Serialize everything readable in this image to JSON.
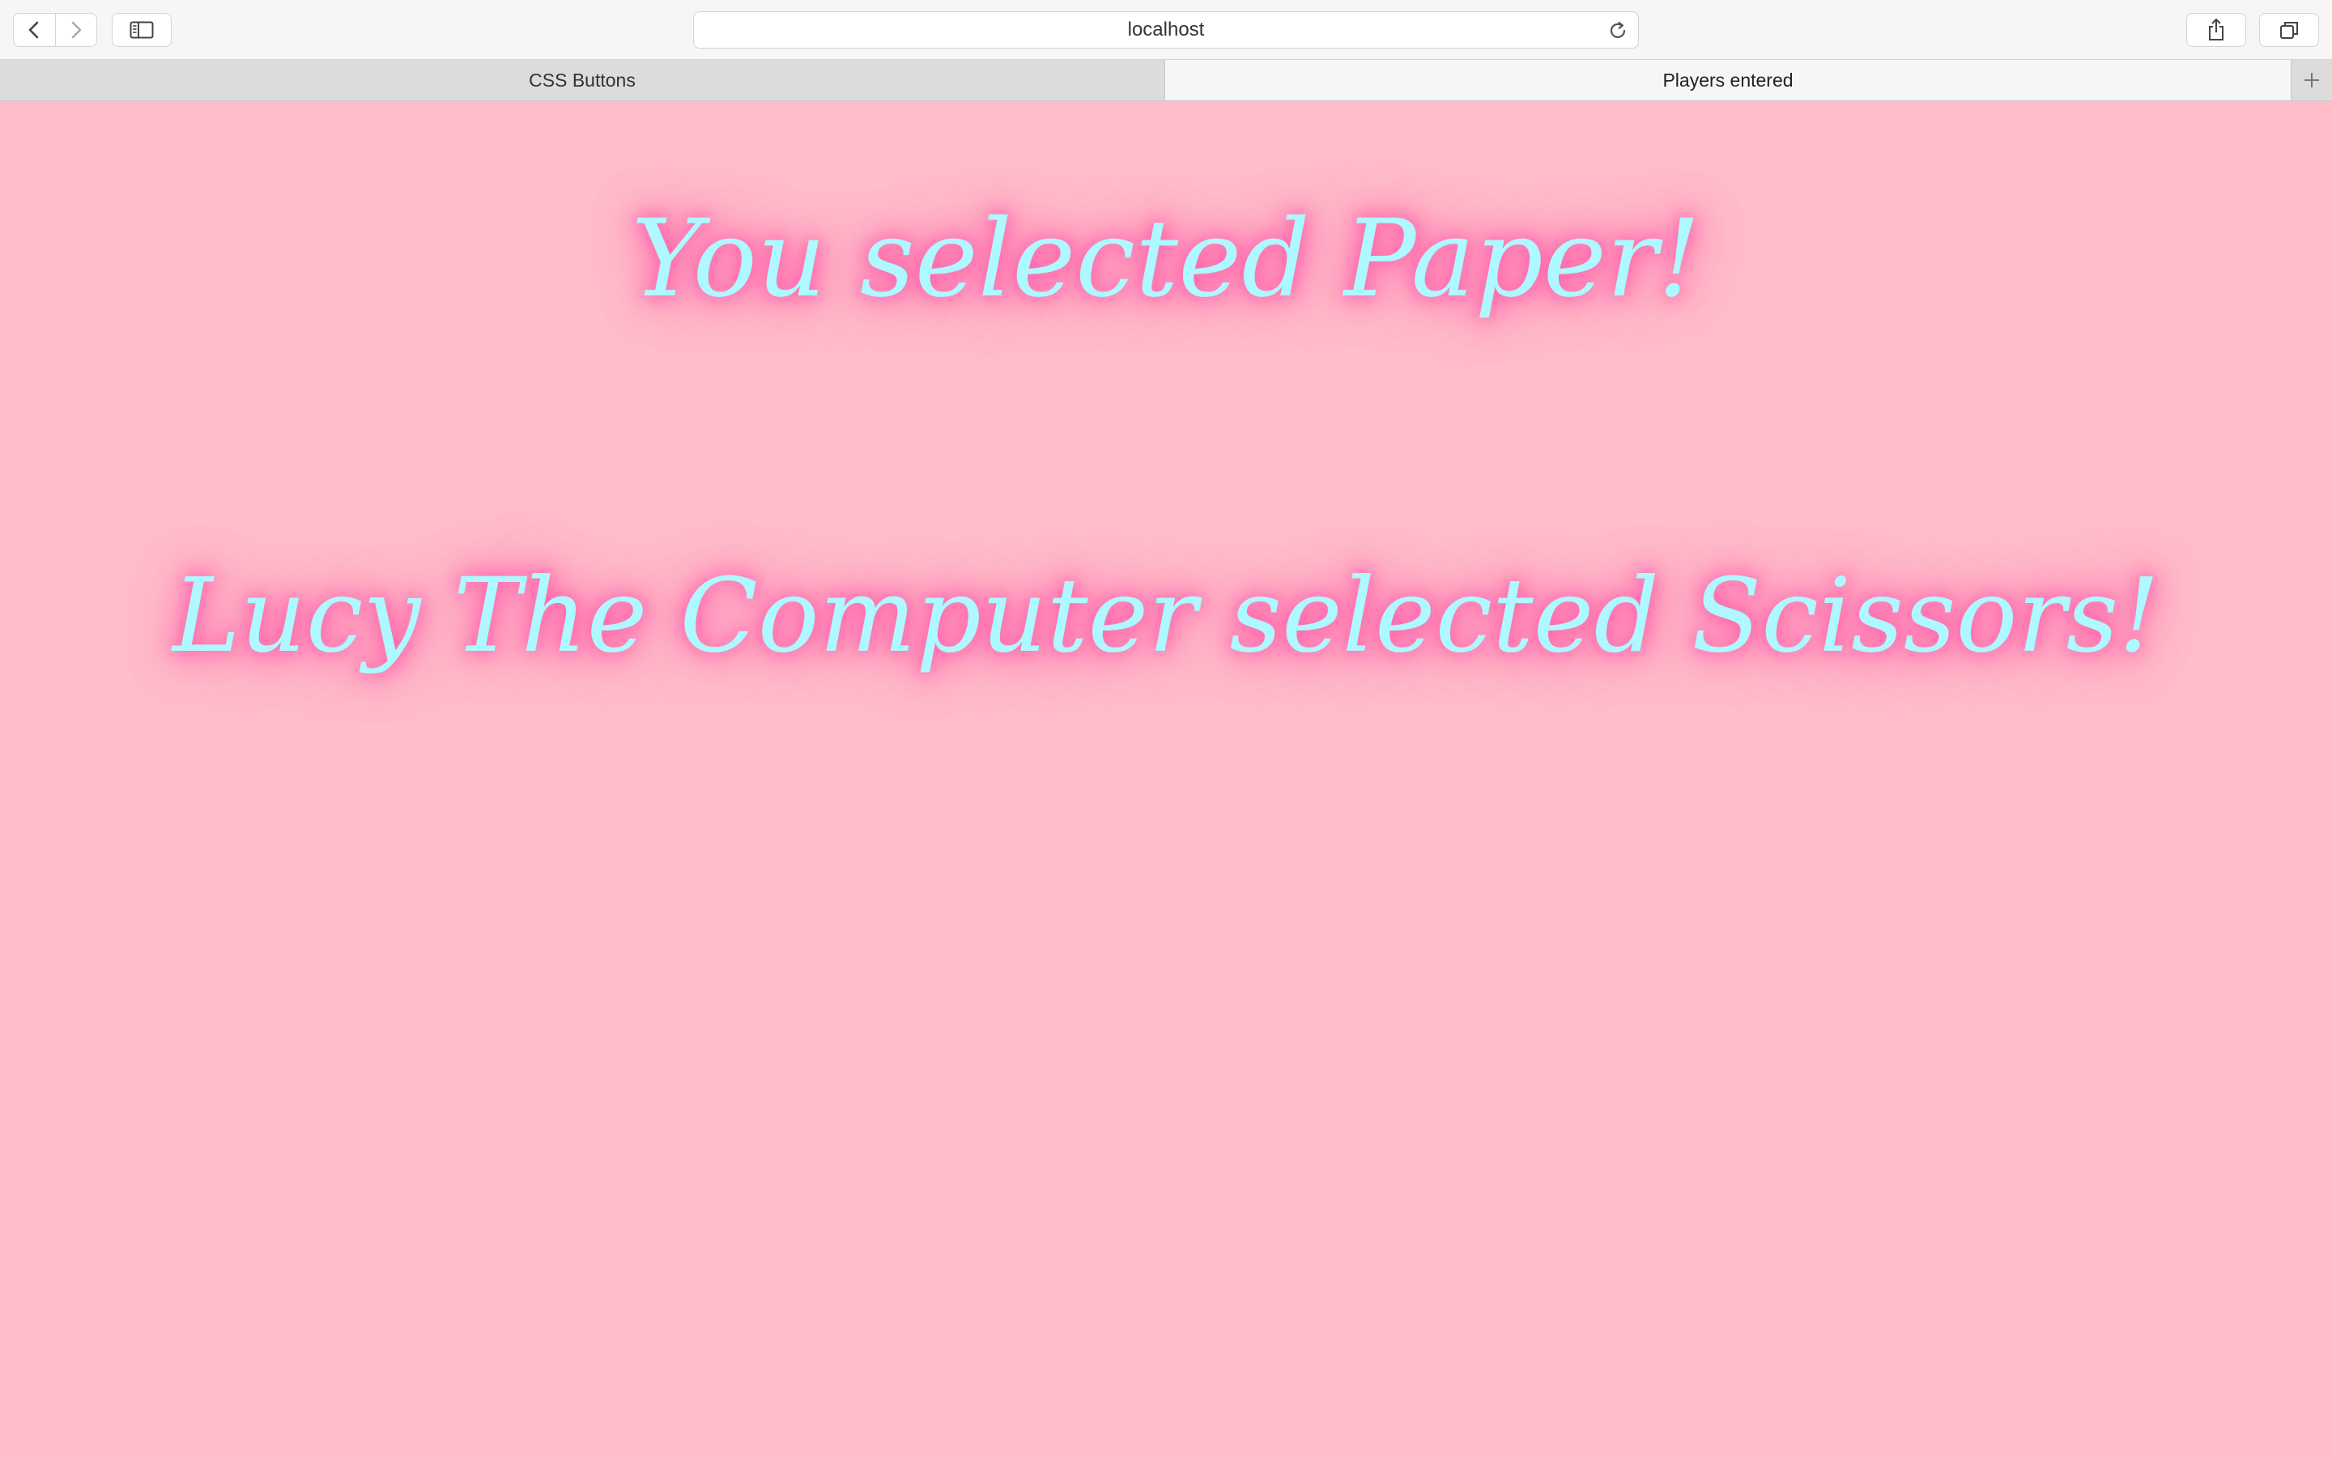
{
  "browser": {
    "address": "localhost",
    "tabs": [
      {
        "label": "CSS Buttons",
        "active": false
      },
      {
        "label": "Players entered",
        "active": true
      }
    ]
  },
  "page": {
    "background_color": "#ffbdc9",
    "text_color": "#aef8ff",
    "glow_color": "#ff5fa8",
    "player_choice_text": "You selected Paper!",
    "computer_choice_text": "Lucy The Computer selected Scissors!"
  },
  "icons": {
    "back": "chevron-left-icon",
    "forward": "chevron-right-icon",
    "sidebar": "sidebar-icon",
    "reload": "reload-icon",
    "share": "share-icon",
    "tabs": "tabs-overview-icon",
    "new_tab": "plus-icon"
  }
}
